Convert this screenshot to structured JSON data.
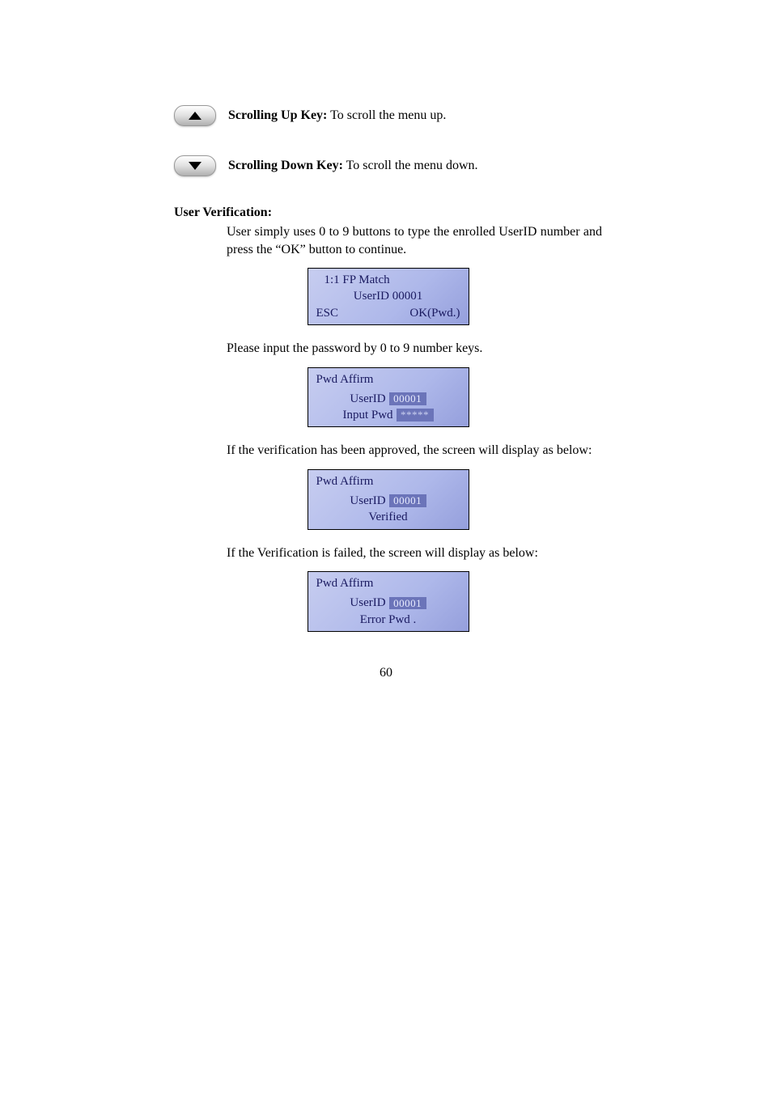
{
  "keys": {
    "up": {
      "title": "Scrolling Up Key:",
      "desc": " To scroll the menu up."
    },
    "down": {
      "title": "Scrolling Down Key:",
      "desc": " To scroll the menu down."
    }
  },
  "section": {
    "heading": "User Verification:",
    "intro": "User simply uses 0 to 9 buttons to type the enrolled UserID number and press the “OK” button to continue.",
    "p_pwd": "Please input the password by 0 to 9 number keys.",
    "p_ok": "If the verification has been approved, the screen will display as below:",
    "p_fail": "If the Verification is failed, the screen will display as below:"
  },
  "screens": {
    "s1": {
      "l1": "1:1  FP  Match",
      "l2": "UserID  00001",
      "esc": "ESC",
      "ok": "OK(Pwd.)"
    },
    "s2": {
      "l1": "Pwd Affirm",
      "label_id": "UserID",
      "val_id": "00001",
      "label_pw": "Input Pwd",
      "val_pw": "*****"
    },
    "s3": {
      "l1": "Pwd Affirm",
      "label_id": "UserID",
      "val_id": "00001",
      "l3": "Verified"
    },
    "s4": {
      "l1": "Pwd Affirm",
      "label_id": "UserID",
      "val_id": "00001",
      "l3": "Error Pwd ."
    }
  },
  "page_number": "60"
}
